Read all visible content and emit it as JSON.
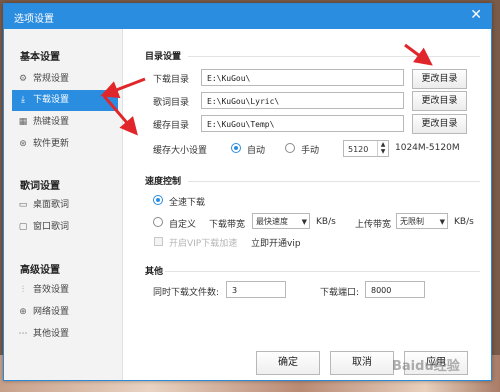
{
  "window": {
    "title": "选项设置",
    "close_glyph": "✕"
  },
  "sidebar": {
    "groups": [
      {
        "title": "基本设置",
        "items": [
          {
            "label": "常规设置",
            "icon": "gear-icon",
            "glyph": "⚙"
          },
          {
            "label": "下载设置",
            "icon": "download-icon",
            "glyph": "⤓",
            "active": true
          },
          {
            "label": "热键设置",
            "icon": "keyboard-icon",
            "glyph": "▦"
          },
          {
            "label": "软件更新",
            "icon": "update-icon",
            "glyph": "⊛"
          }
        ]
      },
      {
        "title": "歌词设置",
        "items": [
          {
            "label": "桌面歌词",
            "icon": "desktop-lyric-icon",
            "glyph": "▭"
          },
          {
            "label": "窗口歌词",
            "icon": "window-lyric-icon",
            "glyph": "▢"
          }
        ]
      },
      {
        "title": "高级设置",
        "items": [
          {
            "label": "音效设置",
            "icon": "equalizer-icon",
            "glyph": "⫶"
          },
          {
            "label": "网络设置",
            "icon": "network-icon",
            "glyph": "⊕"
          },
          {
            "label": "其他设置",
            "icon": "more-icon",
            "glyph": "⋯"
          }
        ]
      }
    ]
  },
  "directory": {
    "section_title": "目录设置",
    "rows": [
      {
        "label": "下载目录",
        "value": "E:\\KuGou\\",
        "button": "更改目录"
      },
      {
        "label": "歌词目录",
        "value": "E:\\KuGou\\Lyric\\",
        "button": "更改目录"
      },
      {
        "label": "缓存目录",
        "value": "E:\\KuGou\\Temp\\",
        "button": "更改目录"
      }
    ],
    "cache_label": "缓存大小设置",
    "cache_auto": "自动",
    "cache_manual": "手动",
    "cache_value": "5120",
    "cache_range": "1024M-5120M"
  },
  "speed": {
    "section_title": "速度控制",
    "full_speed": "全速下载",
    "custom": "自定义",
    "download_bw_label": "下载带宽",
    "download_bw_value": "最快速度",
    "download_unit": "KB/s",
    "upload_bw_label": "上传带宽",
    "upload_bw_value": "无限制",
    "upload_unit": "KB/s",
    "vip_accel": "开启VIP下载加速",
    "vip_link": "立即开通vip"
  },
  "other": {
    "section_title": "其他",
    "concurrent_label": "同时下载文件数:",
    "concurrent_value": "3",
    "port_label": "下载端口:",
    "port_value": "8000"
  },
  "footer": {
    "ok": "确定",
    "cancel": "取消",
    "apply": "应用"
  },
  "watermark": "Baidu经验",
  "colors": {
    "accent": "#2b8de0",
    "arrow": "#e0262b"
  }
}
